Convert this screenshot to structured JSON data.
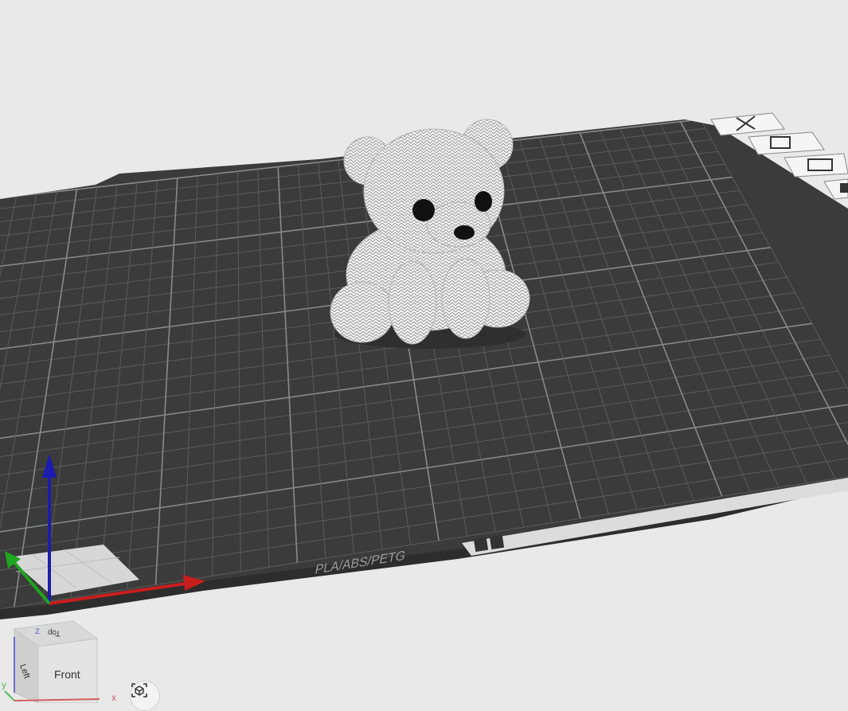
{
  "viewport": {
    "background_color": "#e9e9e9",
    "plate_color": "#3a3b3a",
    "plate_edge_color": "#2c2d2c",
    "grid_line_color": "#5b5c5b",
    "grid_major_color": "#888a88"
  },
  "plate": {
    "label": "PLA/ABS/PETG",
    "side_tab_icons": [
      "close-icon",
      "arrange-icon",
      "layers-icon",
      "settings-icon"
    ]
  },
  "model": {
    "name": "knitted-bear",
    "body_color": "#f2f2f2",
    "eye_color": "#111111"
  },
  "axes": {
    "x_color": "#c81e1e",
    "y_color": "#1fa51f",
    "z_color": "#1c1cb0"
  },
  "view_cube": {
    "front_label": "Front",
    "left_label": "Left",
    "top_label": "Top",
    "x_label": "x",
    "y_label": "y",
    "z_label": "z"
  },
  "snapshot_button": {
    "icon": "camera-cube-icon"
  }
}
